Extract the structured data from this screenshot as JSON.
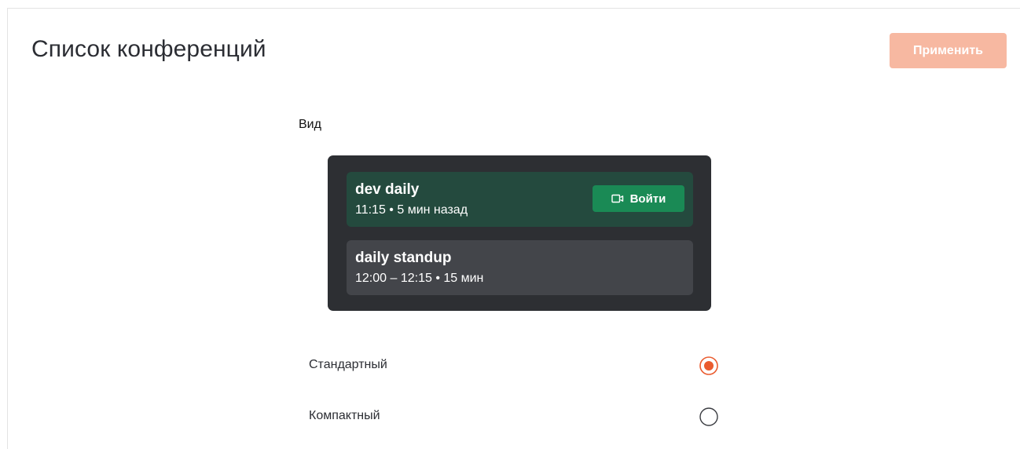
{
  "header": {
    "title": "Список конференций",
    "apply_label": "Применить"
  },
  "view_section": {
    "label": "Вид"
  },
  "preview": {
    "conferences": [
      {
        "title": "dev daily",
        "time": "11:15 • 5 мин назад",
        "join_label": "Войти",
        "status": "active"
      },
      {
        "title": "daily standup",
        "time": "12:00 – 12:15 • 15 мин",
        "status": "upcoming"
      }
    ]
  },
  "options": [
    {
      "label": "Стандартный",
      "selected": true
    },
    {
      "label": "Компактный",
      "selected": false
    }
  ],
  "colors": {
    "accent": "#ea5b2e",
    "apply_disabled": "#f7b8a1",
    "preview_bg": "#2d2f33",
    "active_card": "#244a3e",
    "idle_card": "#43454a",
    "join_button": "#1a8a55"
  },
  "icons": {
    "join": "video-camera-icon"
  }
}
